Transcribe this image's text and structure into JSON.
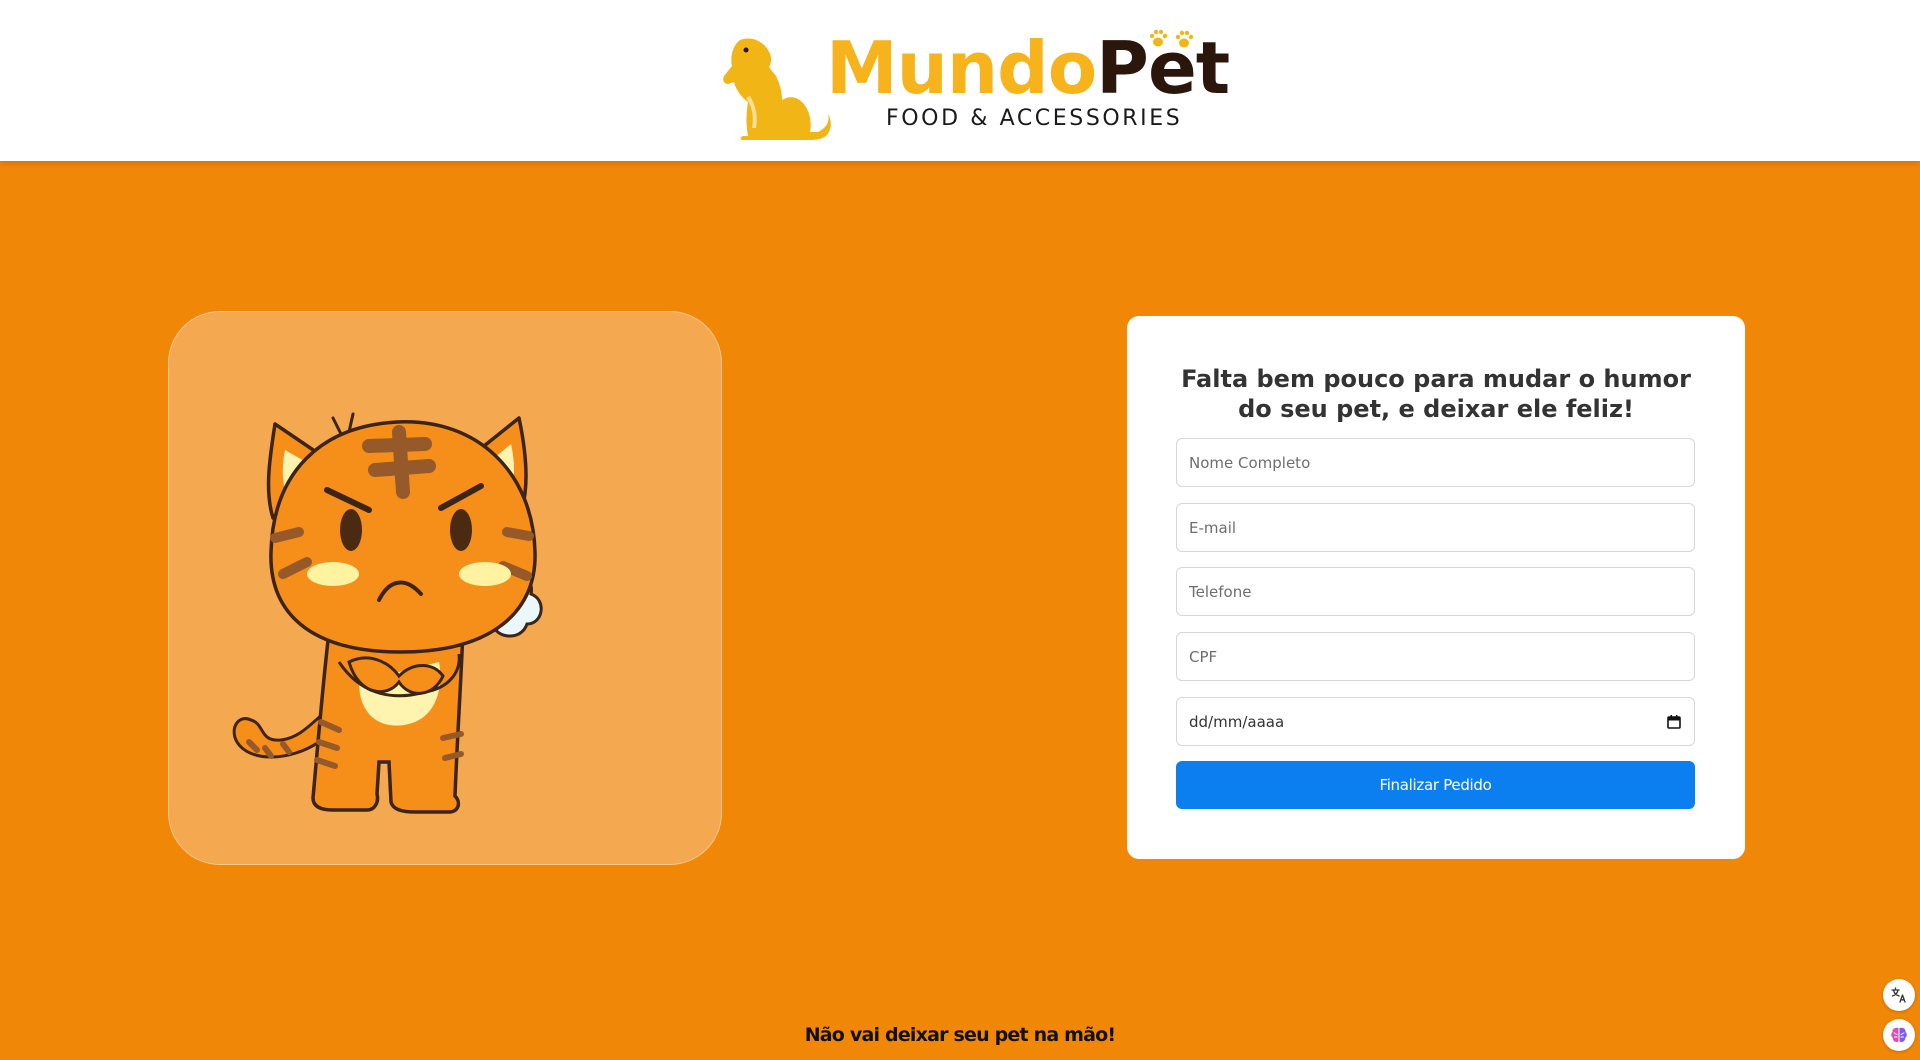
{
  "header": {
    "logo_word_primary": "Mundo",
    "logo_word_secondary": "Pet",
    "logo_tagline": "FOOD & ACCESSORIES",
    "logo_icon": "dog-icon"
  },
  "hero": {
    "illustration": "angry-tiger-cat-illustration"
  },
  "form": {
    "title": "Falta bem pouco para mudar o humor do seu pet, e deixar ele feliz!",
    "fields": {
      "name_placeholder": "Nome Completo",
      "email_placeholder": "E-mail",
      "phone_placeholder": "Telefone",
      "cpf_placeholder": "CPF",
      "date_placeholder": "dd/mm/aaaa"
    },
    "submit_label": "Finalizar Pedido"
  },
  "footer": {
    "text": "Não vai deixar seu pet na mão!"
  },
  "colors": {
    "page_background": "#f08707",
    "hero_card": "#f4a850",
    "brand_yellow": "#f6b31c",
    "brand_dark": "#2b160c",
    "submit_button": "#0b7fef"
  },
  "floating_buttons": [
    "translate-icon",
    "brain-icon"
  ]
}
